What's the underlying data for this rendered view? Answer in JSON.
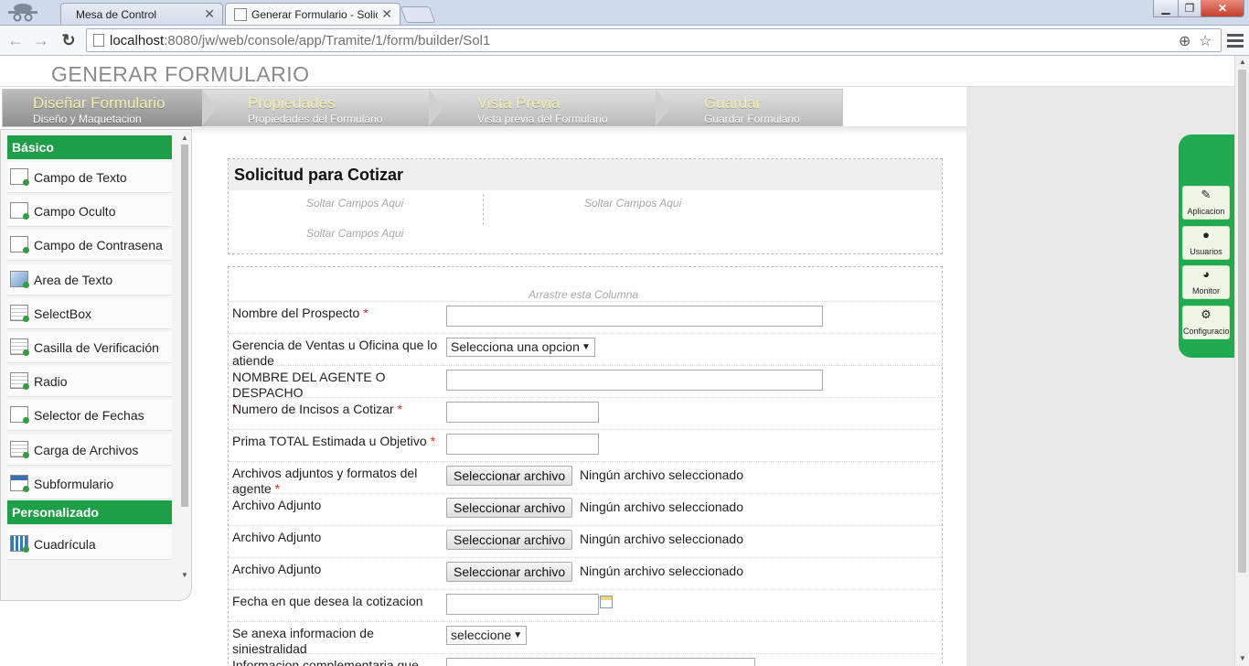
{
  "browser": {
    "tabs": [
      {
        "title": "Mesa de Control",
        "active": false
      },
      {
        "title": "Generar Formulario - Solic",
        "active": true
      }
    ],
    "url_host": "localhost",
    "url_rest": ":8080/jw/web/console/app/Tramite/1/form/builder/Sol1",
    "close_glyph": "✕",
    "back_icon": "arrow-left-icon",
    "forward_icon": "arrow-right-icon",
    "reload_icon": "reload-icon"
  },
  "page": {
    "title": "GENERAR FORMULARIO"
  },
  "steps": [
    {
      "title": "Diseñar Formulario",
      "subtitle": "Diseño y Maquetacion",
      "active": true
    },
    {
      "title": "Propiedades",
      "subtitle": "Propiedades del Formulario",
      "active": false
    },
    {
      "title": "Vista Previa",
      "subtitle": "Vista previa del Formulario",
      "active": false
    },
    {
      "title": "Guardar",
      "subtitle": "Guardar Formulario",
      "active": false
    }
  ],
  "palette": {
    "basic_heading": "Básico",
    "basic_items": [
      "Campo de Texto",
      "Campo Oculto",
      "Campo de Contrasena",
      "Area de Texto",
      "SelectBox",
      "Casilla de Verificación",
      "Radio",
      "Selector de Fechas",
      "Carga de Archivos",
      "Subformulario"
    ],
    "custom_heading": "Personalizado",
    "custom_items": [
      "Cuadrícula"
    ]
  },
  "form": {
    "section_title": "Solicitud para Cotizar",
    "drop_hint": "Soltar Campos Aqui",
    "drag_column_hint": "Arrastre esta Columna",
    "required_mark": "*",
    "fields": {
      "prospecto": "Nombre del Prospecto",
      "gerencia": "Gerencia de Ventas u Oficina que lo atiende",
      "gerencia_select": "Selecciona una opcion",
      "agente": "NOMBRE DEL AGENTE O DESPACHO",
      "incisos": "Numero de Incisos a Cotizar",
      "prima": "Prima TOTAL Estimada u Objetivo",
      "adjuntos": "Archivos adjuntos y formatos del agente",
      "archivo": "Archivo Adjunto",
      "file_button": "Seleccionar archivo",
      "file_status": "Ningún archivo seleccionado",
      "fecha": "Fecha en que desea la cotizacion",
      "siniestralidad": "Se anexa informacion de siniestralidad",
      "siniestralidad_select": "seleccione",
      "complementaria": "Informacion complementaria que"
    }
  },
  "app_menu": [
    {
      "label": "Aplicacion",
      "icon": "edit-icon"
    },
    {
      "label": "Usuarios",
      "icon": "user-icon"
    },
    {
      "label": "Monitor",
      "icon": "dashboard-icon"
    },
    {
      "label": "Configuracio",
      "icon": "gears-icon"
    }
  ],
  "colors": {
    "palette_heading": "#1f9e4a",
    "app_menu": "#22aa52",
    "step_title": "#f3efb0",
    "required": "#d0352b"
  }
}
